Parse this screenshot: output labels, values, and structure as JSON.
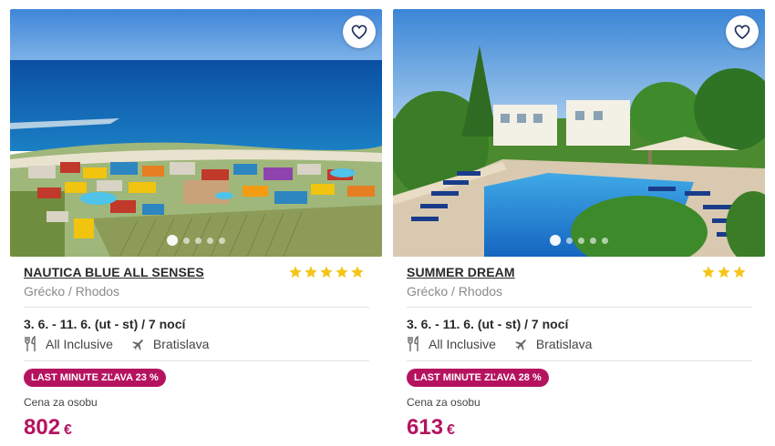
{
  "hotels": [
    {
      "name": "NAUTICA BLUE ALL SENSES",
      "stars": 5,
      "location": "Grécko / Rhodos",
      "dates": "3. 6. - 11. 6. (ut - st) / 7 nocí",
      "board": "All Inclusive",
      "departure": "Bratislava",
      "badge": "LAST MINUTE ZĽAVA 23 %",
      "price_label": "Cena za osobu",
      "price": "802",
      "currency": "€",
      "gallery_images": 5,
      "gallery_active": 1
    },
    {
      "name": "SUMMER DREAM",
      "stars": 3,
      "location": "Grécko / Rhodos",
      "dates": "3. 6. - 11. 6. (ut - st) / 7 nocí",
      "board": "All Inclusive",
      "departure": "Bratislava",
      "badge": "LAST MINUTE ZĽAVA 28 %",
      "price_label": "Cena za osobu",
      "price": "613",
      "currency": "€",
      "gallery_images": 5,
      "gallery_active": 1
    }
  ],
  "colors": {
    "accent": "#b5135f",
    "star": "#f5c518",
    "heart": "#1f2d5c"
  },
  "icons": {
    "favorite": "heart-icon",
    "board": "fork-knife-icon",
    "departure": "airplane-icon",
    "rating": "star-icon"
  }
}
